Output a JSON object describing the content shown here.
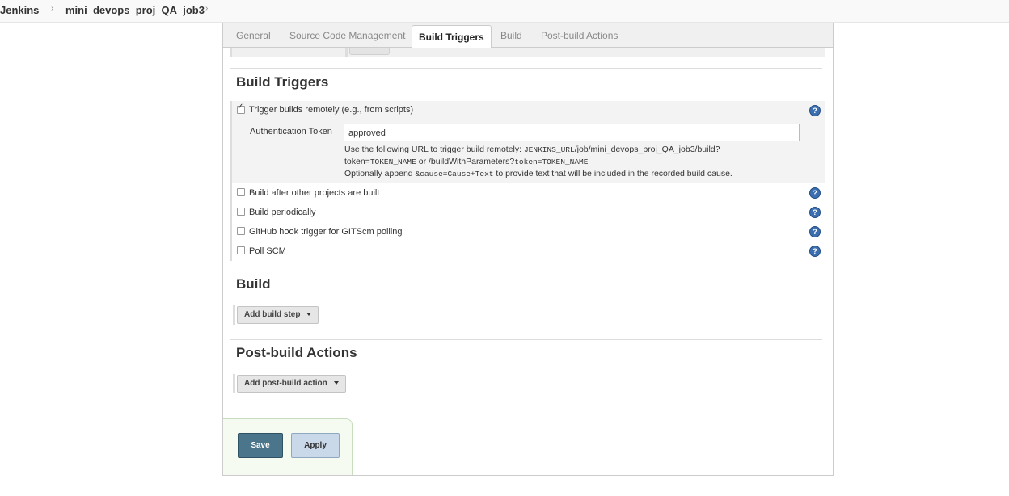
{
  "breadcrumb": {
    "items": [
      "Jenkins",
      "mini_devops_proj_QA_job3"
    ],
    "separator": "›"
  },
  "tabs": [
    {
      "label": "General",
      "active": false
    },
    {
      "label": "Source Code Management",
      "active": false
    },
    {
      "label": "Build Triggers",
      "active": true
    },
    {
      "label": "Build",
      "active": false
    },
    {
      "label": "Post-build Actions",
      "active": false
    }
  ],
  "build_triggers": {
    "title": "Build Triggers",
    "remote": {
      "label": "Trigger builds remotely (e.g., from scripts)",
      "checked": true,
      "auth_token_label": "Authentication Token",
      "auth_token_value": "approved",
      "desc_line1_a": "Use the following URL to trigger build remotely: ",
      "desc_line1_b": "JENKINS_URL",
      "desc_line1_c": "/job/mini_devops_proj_QA_job3/build?",
      "desc_line2_a": "token=",
      "desc_line2_b": "TOKEN_NAME",
      "desc_line2_c": " or /buildWithParameters?",
      "desc_line2_d": "token=TOKEN_NAME",
      "desc_line3_a": "Optionally append ",
      "desc_line3_b": "&cause=Cause+Text",
      "desc_line3_c": " to provide text that will be included in the recorded build cause."
    },
    "options": [
      {
        "label": "Build after other projects are built",
        "checked": false
      },
      {
        "label": "Build periodically",
        "checked": false
      },
      {
        "label": "GitHub hook trigger for GITScm polling",
        "checked": false
      },
      {
        "label": "Poll SCM",
        "checked": false
      }
    ],
    "help_glyph": "?"
  },
  "build": {
    "title": "Build",
    "add_step_label": "Add build step"
  },
  "post_build": {
    "title": "Post-build Actions",
    "add_action_label": "Add post-build action"
  },
  "footer": {
    "save_label": "Save",
    "apply_label": "Apply"
  },
  "colors": {
    "save_bg": "#4b758b",
    "apply_bg": "#c9d9ea",
    "help_icon": "#3c6fb0"
  }
}
